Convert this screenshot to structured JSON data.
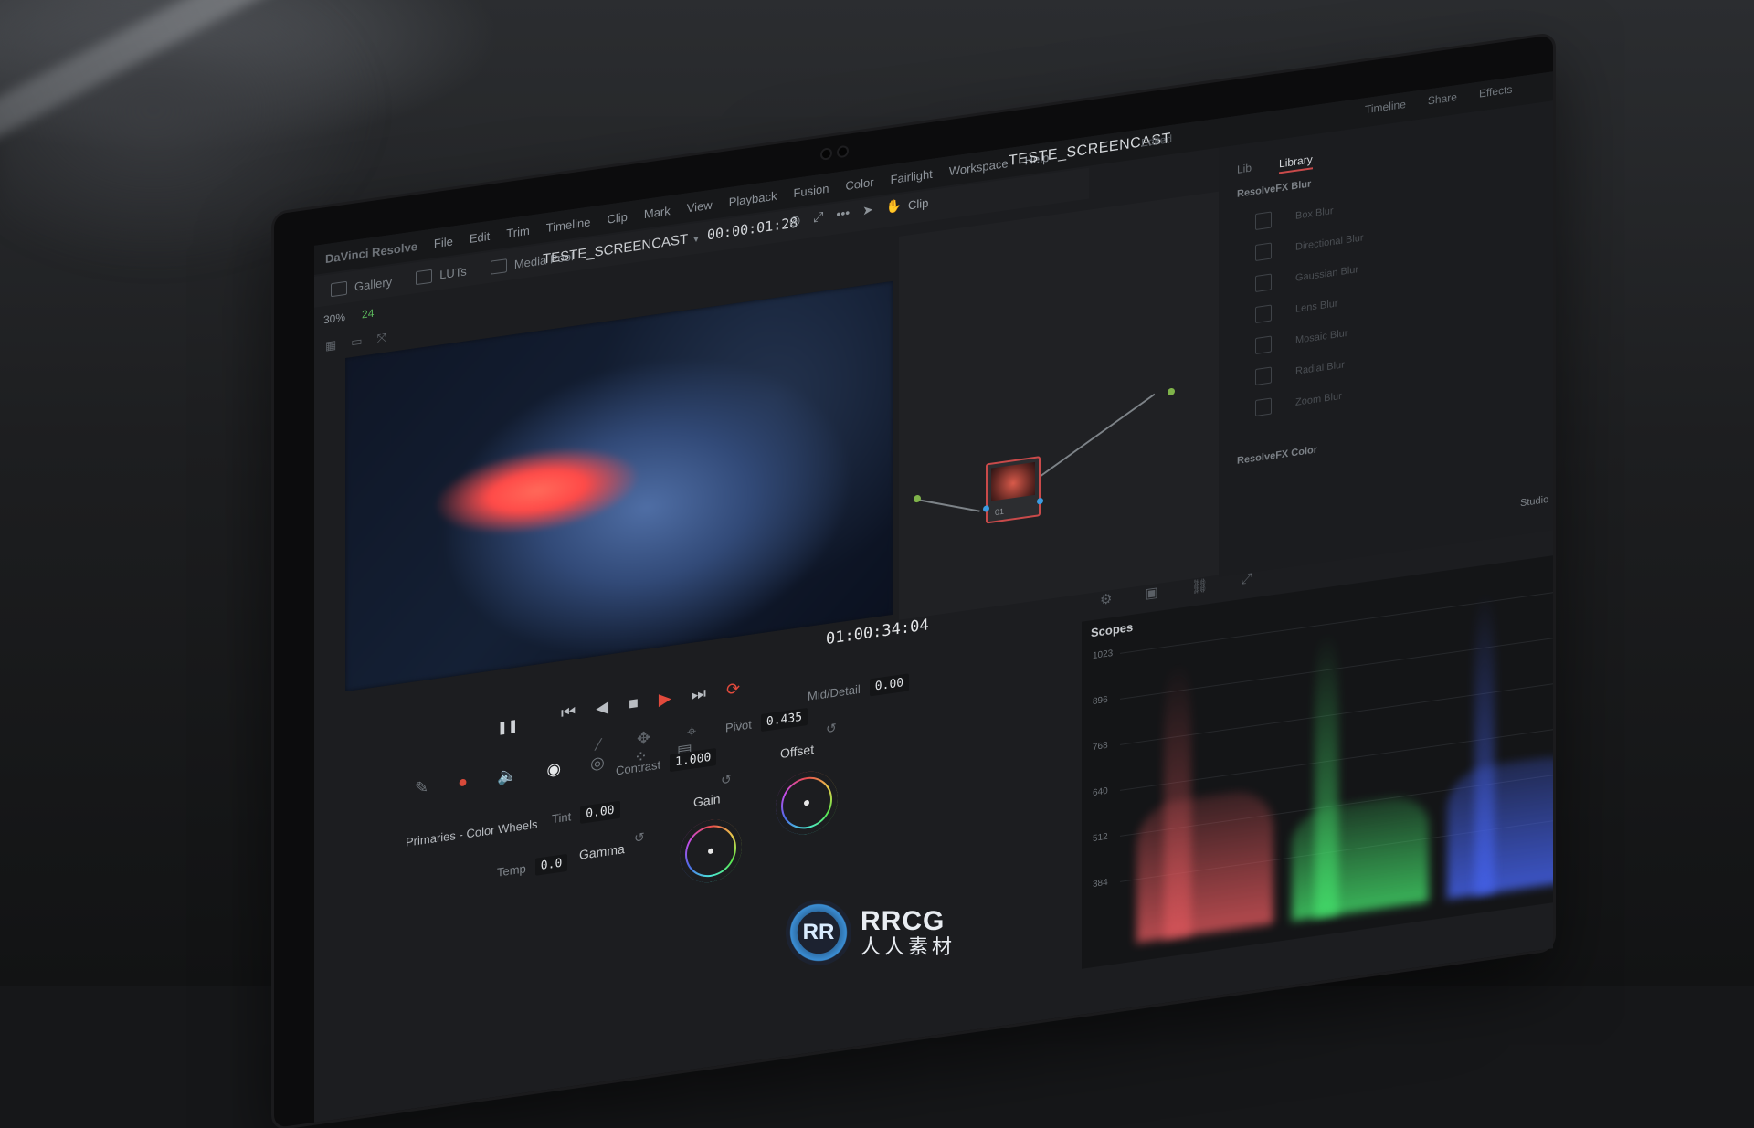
{
  "menu": {
    "app": "DaVinci Resolve",
    "items": [
      "File",
      "Edit",
      "Trim",
      "Timeline",
      "Clip",
      "Mark",
      "View",
      "Playback",
      "Fusion",
      "Color",
      "Fairlight",
      "Workspace",
      "Help"
    ]
  },
  "project": {
    "title": "TESTE_SCREENCAST",
    "status": "Edited"
  },
  "top_right": {
    "timeline": "Timeline",
    "share": "Share",
    "effects": "Effects"
  },
  "toolbar": {
    "gallery": "Gallery",
    "luts": "LUTs",
    "media_pool": "Media Pool"
  },
  "viewer": {
    "clip_name": "TESTE_SCREENCAST",
    "timecode_top": "00:00:01:28",
    "zoom": "30%",
    "fps": "24",
    "timecode_bottom": "01:00:34:04",
    "clip_mode": "Clip"
  },
  "library": {
    "tabs": [
      "Lib",
      "Library"
    ],
    "header_ofx": "ResolveFX Blur",
    "header_color": "ResolveFX Color",
    "items": [
      "Box Blur",
      "Directional Blur",
      "Gaussian Blur",
      "Lens Blur",
      "Mosaic Blur",
      "Radial Blur",
      "Zoom Blur"
    ],
    "bottom_label": "Studio"
  },
  "primaries": {
    "title": "Primaries - Color Wheels",
    "temp_label": "Temp",
    "temp_value": "0.0",
    "tint_label": "Tint",
    "tint_value": "0.00",
    "contrast_label": "Contrast",
    "contrast_value": "1.000",
    "pivot_label": "Pivot",
    "pivot_value": "0.435",
    "middetail_label": "Mid/Detail",
    "middetail_value": "0.00",
    "wheel_gamma": "Gamma",
    "wheel_gain": "Gain",
    "wheel_offset": "Offset"
  },
  "scopes": {
    "label": "Scopes",
    "ticks": [
      "1023",
      "896",
      "768",
      "640",
      "512",
      "384"
    ]
  },
  "watermark": {
    "logo": "RR",
    "line1": "RRCG",
    "line2": "人人素材"
  },
  "colors": {
    "accent": "#e24a3c",
    "node_border": "#c94a4a",
    "node_dot": "#7fb34a"
  }
}
